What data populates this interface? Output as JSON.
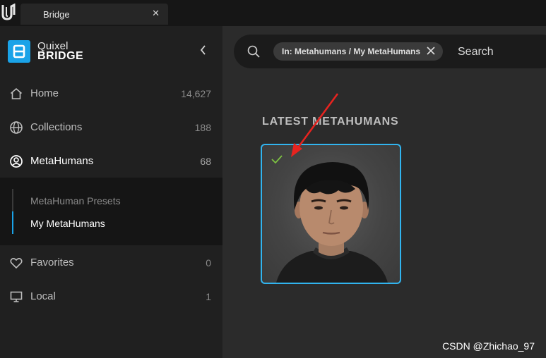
{
  "tab": {
    "title": "Bridge",
    "close_label": "✕"
  },
  "brand": {
    "line1": "Quixel",
    "line2": "BRIDGE"
  },
  "sidebar": {
    "items": [
      {
        "label": "Home",
        "count": "14,627",
        "icon": "home-icon"
      },
      {
        "label": "Collections",
        "count": "188",
        "icon": "globe-icon"
      },
      {
        "label": "MetaHumans",
        "count": "68",
        "icon": "user-circle-icon",
        "active": true
      },
      {
        "label": "Favorites",
        "count": "0",
        "icon": "heart-icon"
      },
      {
        "label": "Local",
        "count": "1",
        "icon": "monitor-icon"
      }
    ],
    "submenu": [
      {
        "label": "MetaHuman Presets",
        "active": false
      },
      {
        "label": "My MetaHumans",
        "active": true
      }
    ]
  },
  "search": {
    "filter_chip": "In: Metahumans / My MetaHumans",
    "placeholder": "Search",
    "value": ""
  },
  "main": {
    "section_title": "LATEST METAHUMANS"
  },
  "watermark": "CSDN @Zhichao_97",
  "colors": {
    "accent": "#1aa3e8",
    "card_border": "#31b4ef",
    "check": "#7dc142",
    "arrow": "#e8231f"
  }
}
